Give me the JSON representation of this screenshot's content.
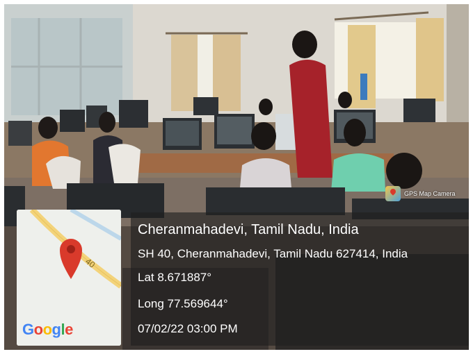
{
  "app": {
    "name": "GPS Map Camera",
    "icon": "gps-map-camera-icon"
  },
  "map": {
    "road_label": "40",
    "pin_icon": "map-pin-icon",
    "attribution": "Google",
    "attribution_colors": [
      "#4285F4",
      "#EA4335",
      "#FBBC05",
      "#4285F4",
      "#34A853",
      "#EA4335"
    ]
  },
  "location": {
    "title": "Cheranmahadevi, Tamil Nadu, India",
    "address": "SH 40, Cheranmahadevi, Tamil Nadu 627414, India",
    "latitude": "Lat 8.671887°",
    "longitude": "Long 77.569644°",
    "timestamp": "07/02/22 03:00 PM"
  },
  "colors": {
    "pin": "#D93A2B",
    "road": "#F3D37A",
    "panel": "#1E1E1E"
  }
}
